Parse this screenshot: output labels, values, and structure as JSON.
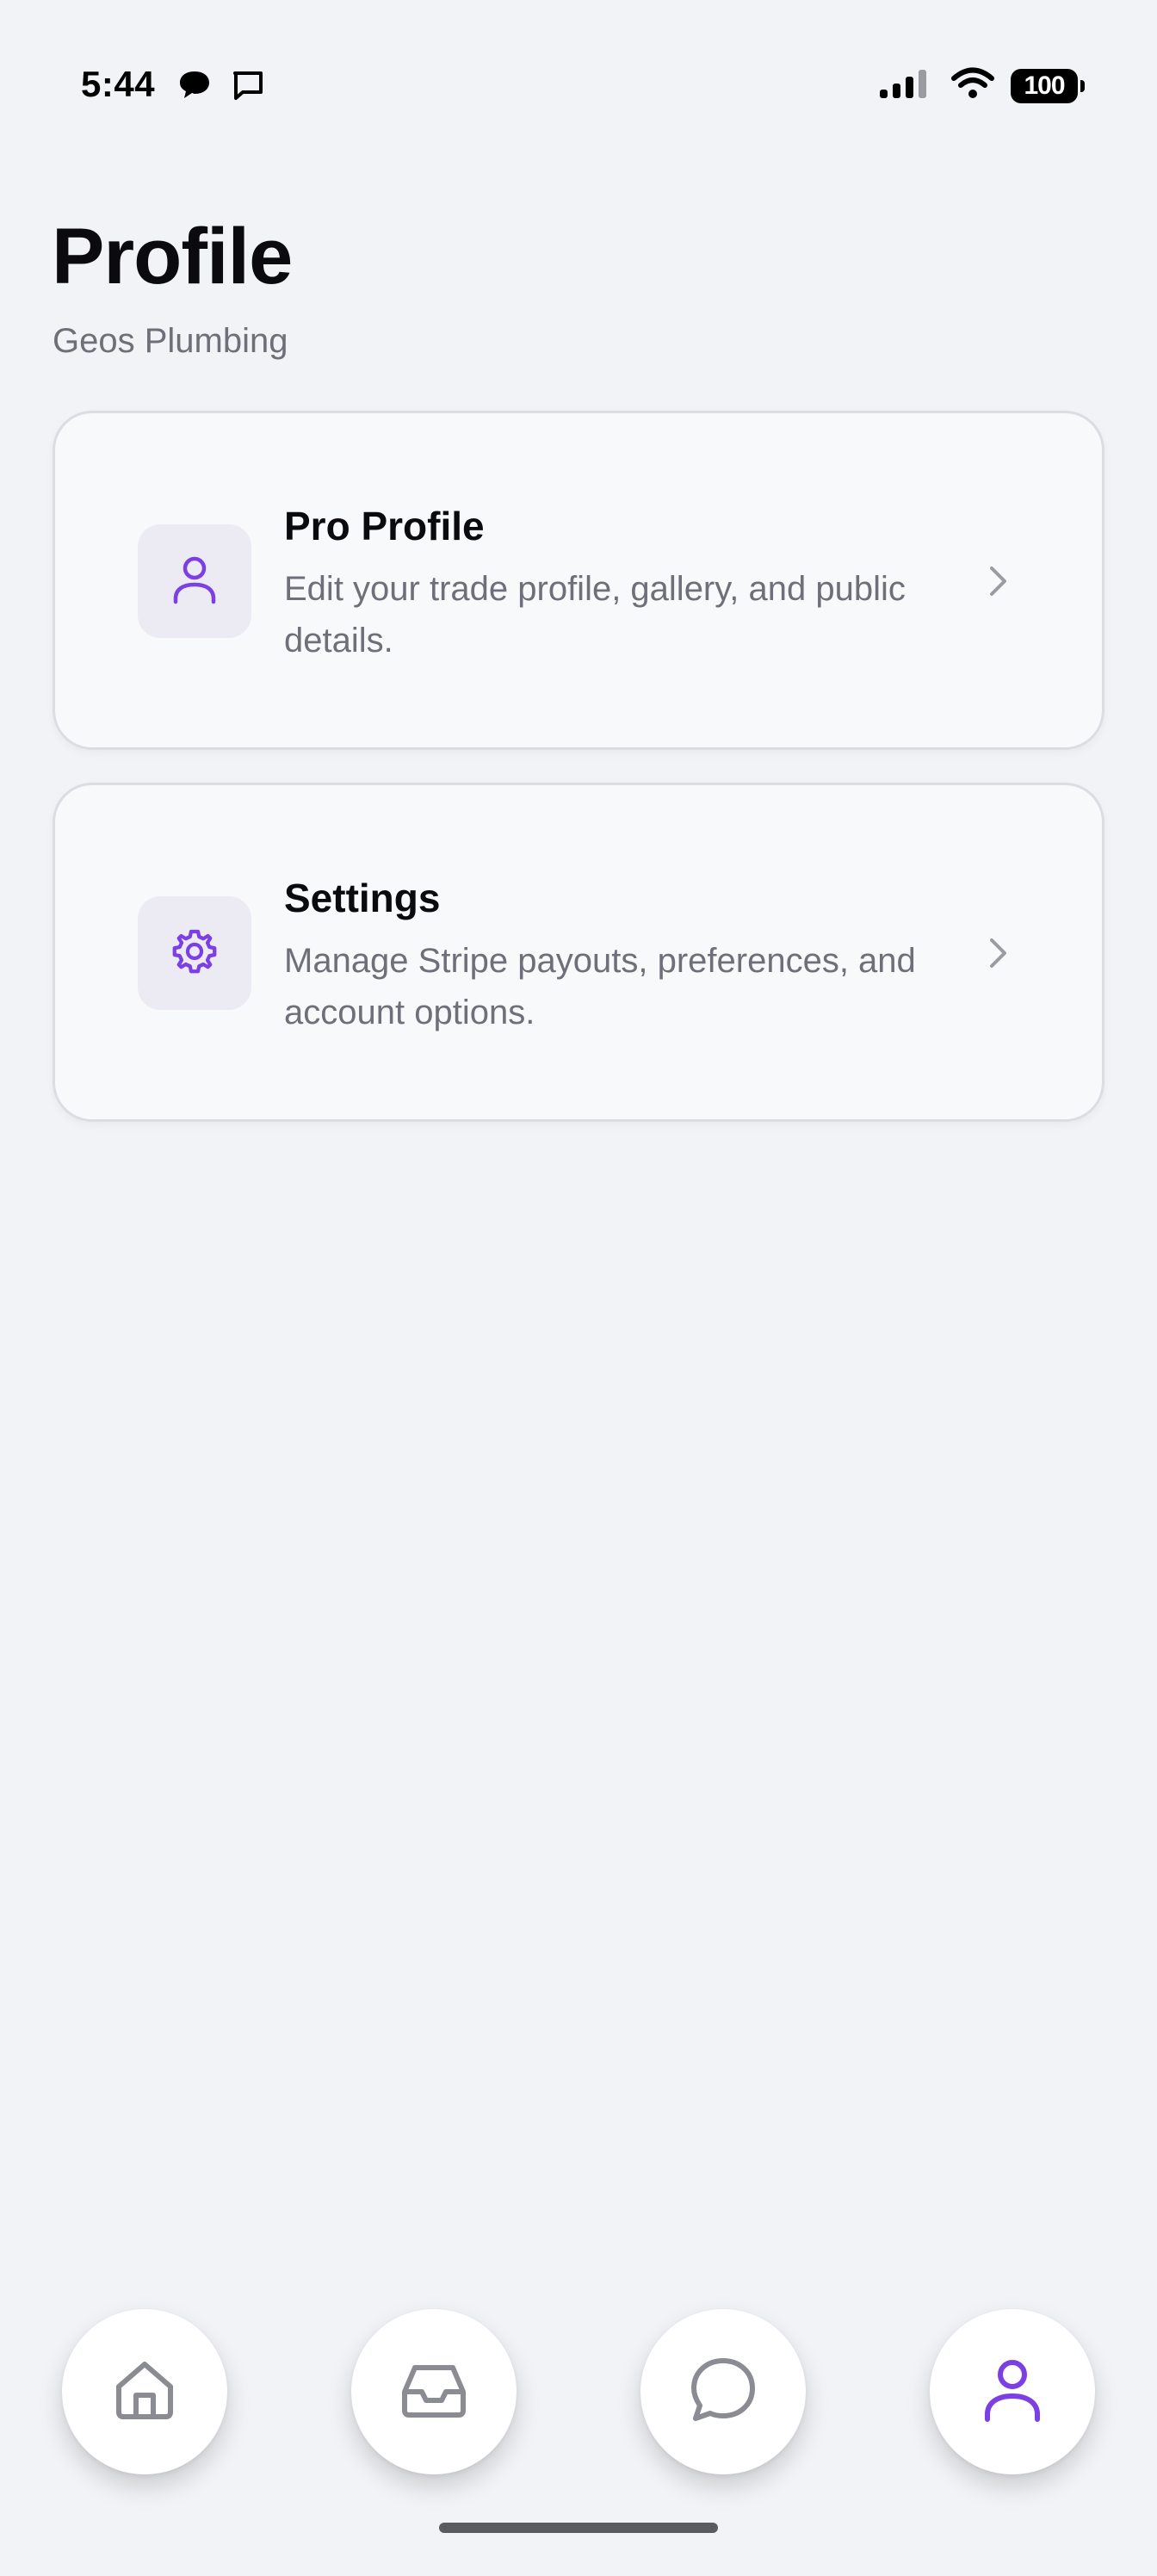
{
  "status_bar": {
    "time": "5:44",
    "battery": "100",
    "icons": [
      "chat-bubble-icon",
      "message-square-icon",
      "signal-icon",
      "wifi-icon",
      "battery-icon"
    ]
  },
  "header": {
    "title": "Profile",
    "subtitle": "Geos Plumbing"
  },
  "cards": [
    {
      "title": "Pro Profile",
      "description": "Edit your trade profile, gallery, and public details.",
      "icon": "user-icon"
    },
    {
      "title": "Settings",
      "description": "Manage Stripe payouts, preferences, and account options.",
      "icon": "gear-icon"
    }
  ],
  "bottom_nav": {
    "items": [
      {
        "icon": "home-icon",
        "active": false
      },
      {
        "icon": "inbox-icon",
        "active": false
      },
      {
        "icon": "chat-icon",
        "active": false
      },
      {
        "icon": "profile-icon",
        "active": true
      }
    ]
  },
  "colors": {
    "accent": "#7b3fe4",
    "inactive_icon": "#8a8b93",
    "background": "#f2f3f6",
    "card_background": "#f8f9fb",
    "icon_tile": "#ecebf4"
  }
}
